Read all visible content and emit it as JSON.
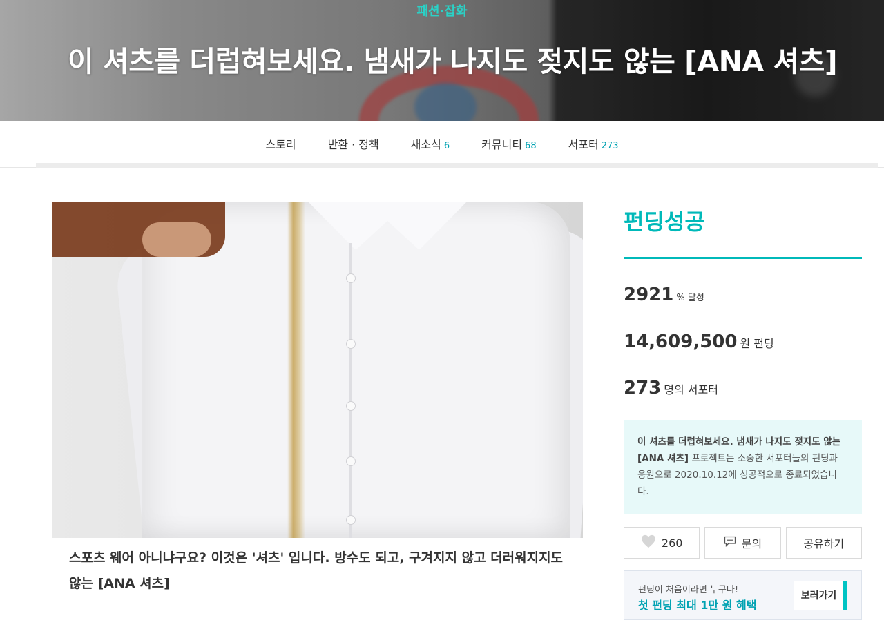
{
  "hero": {
    "category": "패션·잡화",
    "title": "이 셔츠를 더럽혀보세요. 냄새가 나지도 젖지도 않는 [ANA 셔츠]"
  },
  "tabs": [
    {
      "label": "스토리",
      "count": ""
    },
    {
      "label": "반환 · 정책",
      "count": ""
    },
    {
      "label": "새소식",
      "count": "6"
    },
    {
      "label": "커뮤니티",
      "count": "68"
    },
    {
      "label": "서포터",
      "count": "273"
    }
  ],
  "caption": "스포츠 웨어 아니냐구요? 이것은 '셔츠' 입니다. 방수도 되고, 구겨지지 않고 더러워지지도 않는 [ANA 셔츠]",
  "panel": {
    "status": "펀딩성공",
    "achieve": {
      "value": "2921",
      "unit": "% 달성"
    },
    "amount": {
      "value": "14,609,500",
      "unit": "원 펀딩"
    },
    "supporters": {
      "value": "273",
      "unit": "명의 서포터"
    },
    "notice": {
      "bold": "이 셔츠를 더럽혀보세요. 냄새가 나지도 젖지도 않는 [ANA 셔츠]",
      "rest": " 프로젝트는 소중한 서포터들의 펀딩과 응원으로 2020.10.12에 성공적으로 종료되었습니다."
    },
    "like_count": "260",
    "inquiry_label": "문의",
    "share_label": "공유하기",
    "promo": {
      "line1": "펀딩이 처음이라면 누구나!",
      "line2": "첫 펀딩 최대 1만 원 혜택",
      "button": "보러가기"
    }
  },
  "colors": {
    "accent": "#00b9b9",
    "accent_dark": "#00a2b2",
    "notice_bg": "#e7f9f9"
  }
}
